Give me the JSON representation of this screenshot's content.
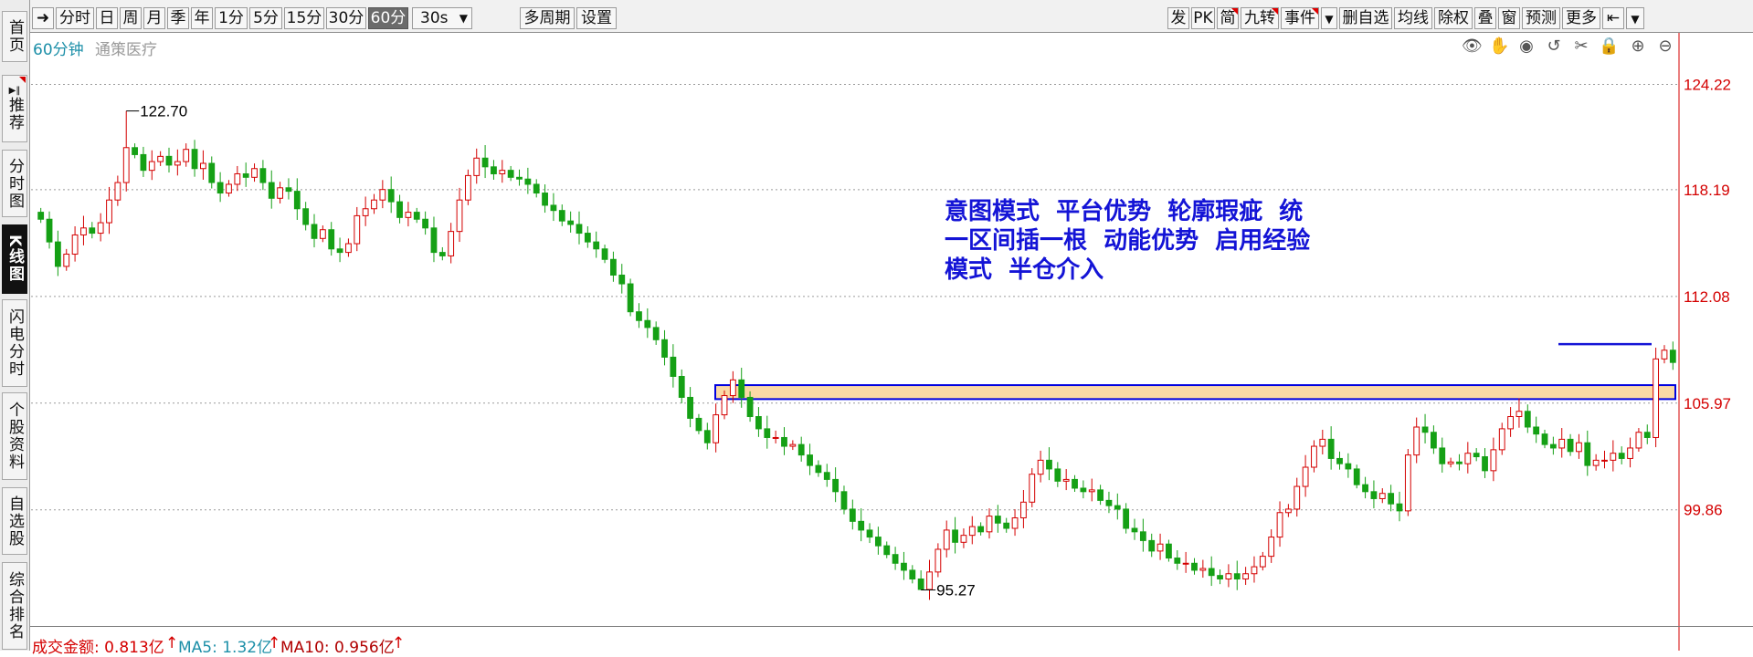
{
  "sidebar": {
    "tabs": [
      {
        "label": "首页",
        "active": false
      },
      {
        "label": "推荐",
        "active": false,
        "prefix_icon": "play-pause-icon"
      },
      {
        "label": "分时图",
        "active": false
      },
      {
        "label": "K线图",
        "active": true
      },
      {
        "label": "闪电分时",
        "active": false
      },
      {
        "label": "个股资料",
        "active": false
      },
      {
        "label": "自选股",
        "active": false
      },
      {
        "label": "综合排名",
        "active": false
      }
    ]
  },
  "toolbar": {
    "left_buttons": [
      "分时",
      "日",
      "周",
      "月",
      "季",
      "年",
      "1分",
      "5分",
      "15分",
      "30分",
      "60分",
      "30s",
      "多周期",
      "设置"
    ],
    "selected": "60分",
    "right_buttons": [
      "发",
      "PK",
      "简",
      "九转",
      "事件",
      "删自选",
      "均线",
      "除权",
      "叠",
      "窗",
      "预测",
      "更多"
    ]
  },
  "chart_header": {
    "period": "60分钟",
    "stock_name": "通策医疗",
    "tools": [
      "eye-icon",
      "hand-icon",
      "play-icon",
      "undo-icon",
      "scissors-icon",
      "lock-icon",
      "zoom-in-icon",
      "zoom-out-icon"
    ]
  },
  "price_axis": {
    "ticks": [
      "124.22",
      "118.19",
      "112.08",
      "105.97",
      "99.86"
    ]
  },
  "annotation": {
    "lines": [
      "意图模式  平台优势  轮廓瑕疵  统",
      "一区间插一根  动能优势  启用经验",
      "模式  半仓介入"
    ]
  },
  "volume_bar": {
    "amount_label": "成交金额: 0.813亿",
    "ma5_label": "MA5: 1.32亿",
    "ma10_label": "MA10: 0.956亿",
    "colors": {
      "amount": "#d40000",
      "ma5": "#1c8fa8",
      "ma10": "#b00000"
    }
  },
  "chart_data": {
    "type": "candlestick",
    "period": "60分钟",
    "ylim": [
      93.0,
      125.5
    ],
    "y_ticks": [
      124.22,
      118.19,
      112.08,
      105.97,
      99.86
    ],
    "grid": true,
    "high_marker": "122.70",
    "low_marker": "95.27",
    "high_value": 122.7,
    "low_value": 95.27,
    "support_band": [
      106.2,
      107.0
    ],
    "resistance_line": 109.35,
    "up_color": "#d40000",
    "down_color": "#15a015",
    "closes": [
      116.5,
      115.2,
      113.8,
      114.5,
      115.6,
      116.0,
      115.7,
      116.3,
      117.6,
      118.6,
      120.6,
      120.2,
      119.3,
      119.8,
      120.1,
      119.6,
      119.8,
      120.5,
      119.4,
      119.7,
      118.6,
      118.0,
      118.5,
      119.1,
      118.9,
      119.4,
      118.6,
      117.7,
      118.3,
      118.1,
      117.1,
      116.2,
      115.4,
      115.9,
      114.8,
      114.6,
      115.1,
      116.7,
      117.1,
      117.6,
      118.2,
      117.5,
      116.6,
      116.9,
      116.5,
      116.0,
      114.6,
      114.4,
      115.8,
      117.6,
      119.0,
      120.0,
      119.5,
      119.1,
      119.3,
      118.9,
      118.8,
      118.5,
      118.0,
      117.3,
      117.0,
      116.4,
      116.2,
      115.7,
      115.2,
      114.8,
      114.2,
      113.3,
      112.8,
      111.2,
      110.7,
      110.3,
      109.6,
      108.6,
      107.5,
      106.3,
      105.1,
      104.4,
      103.7,
      105.3,
      106.4,
      107.3,
      106.3,
      105.2,
      104.5,
      104.0,
      104.0,
      103.5,
      103.6,
      103.0,
      102.4,
      102.0,
      101.6,
      100.9,
      99.9,
      99.2,
      98.7,
      98.3,
      97.8,
      97.3,
      96.8,
      96.4,
      95.9,
      95.3,
      96.3,
      97.6,
      98.7,
      98.0,
      98.4,
      98.9,
      98.6,
      99.5,
      99.1,
      98.8,
      99.4,
      100.3,
      101.9,
      102.7,
      102.2,
      101.5,
      101.6,
      101.1,
      100.9,
      101.0,
      100.4,
      100.1,
      99.9,
      98.8,
      98.6,
      98.1,
      97.5,
      97.9,
      97.1,
      96.8,
      96.8,
      96.4,
      96.5,
      96.1,
      95.9,
      96.2,
      95.9,
      96.2,
      96.6,
      97.2,
      98.3,
      99.7,
      99.9,
      101.2,
      102.3,
      103.5,
      103.9,
      102.8,
      102.5,
      102.2,
      101.3,
      100.9,
      100.5,
      100.8,
      100.2,
      99.8,
      103.0,
      104.6,
      104.3,
      103.4,
      102.5,
      102.6,
      102.5,
      103.1,
      102.9,
      102.1,
      103.3,
      104.5,
      105.2,
      105.5,
      104.6,
      104.2,
      103.6,
      103.4,
      103.9,
      103.2,
      103.7,
      102.4,
      102.7,
      102.7,
      103.1,
      102.8,
      103.4,
      104.3,
      104.0,
      108.5,
      109.0,
      108.3
    ]
  }
}
